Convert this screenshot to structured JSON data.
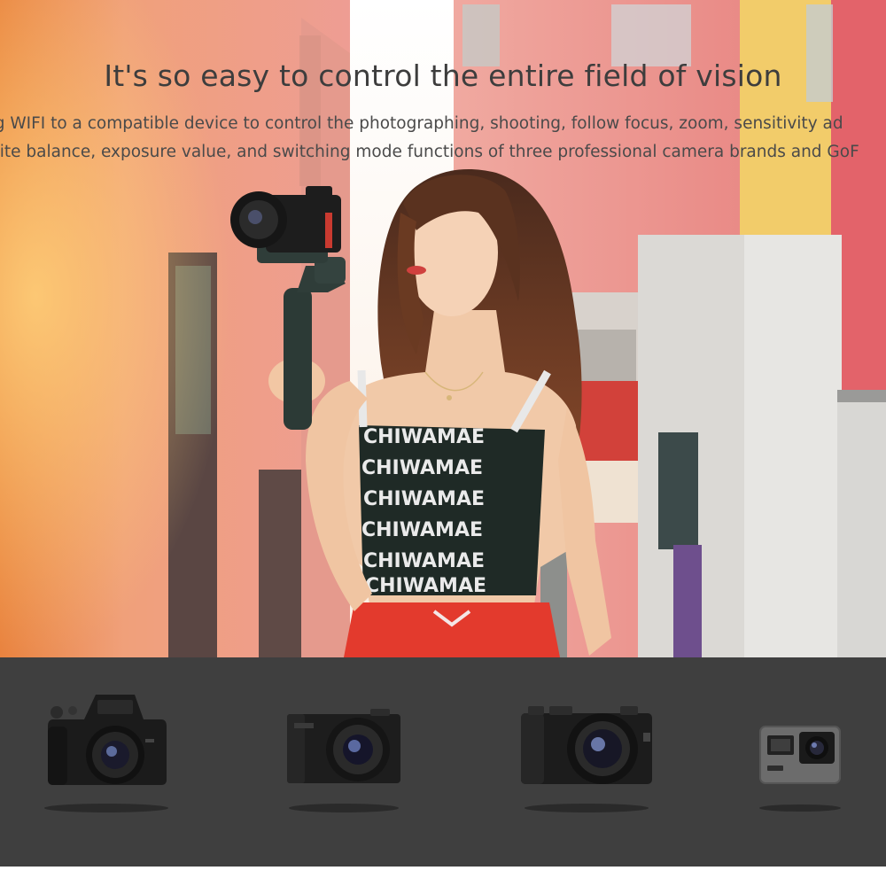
{
  "hero": {
    "headline": "It's so easy to control the entire field of vision",
    "description_line1": "ng WIFI to a compatible device to control the photographing, shooting, follow focus, zoom, sensitivity ad",
    "description_line2": "hite balance, exposure value, and switching mode functions of three professional camera brands and GoF",
    "top_print": "CHIWAMAE",
    "colors": {
      "headline_text": "#3d3d3d",
      "body_text": "#4a4a4a",
      "strip_background": "#3f3f3f"
    }
  },
  "cameras": [
    {
      "name": "mirrorless-camera-icon"
    },
    {
      "name": "compact-camera-icon"
    },
    {
      "name": "aps-c-mirrorless-camera-icon"
    },
    {
      "name": "action-camera-icon"
    }
  ]
}
